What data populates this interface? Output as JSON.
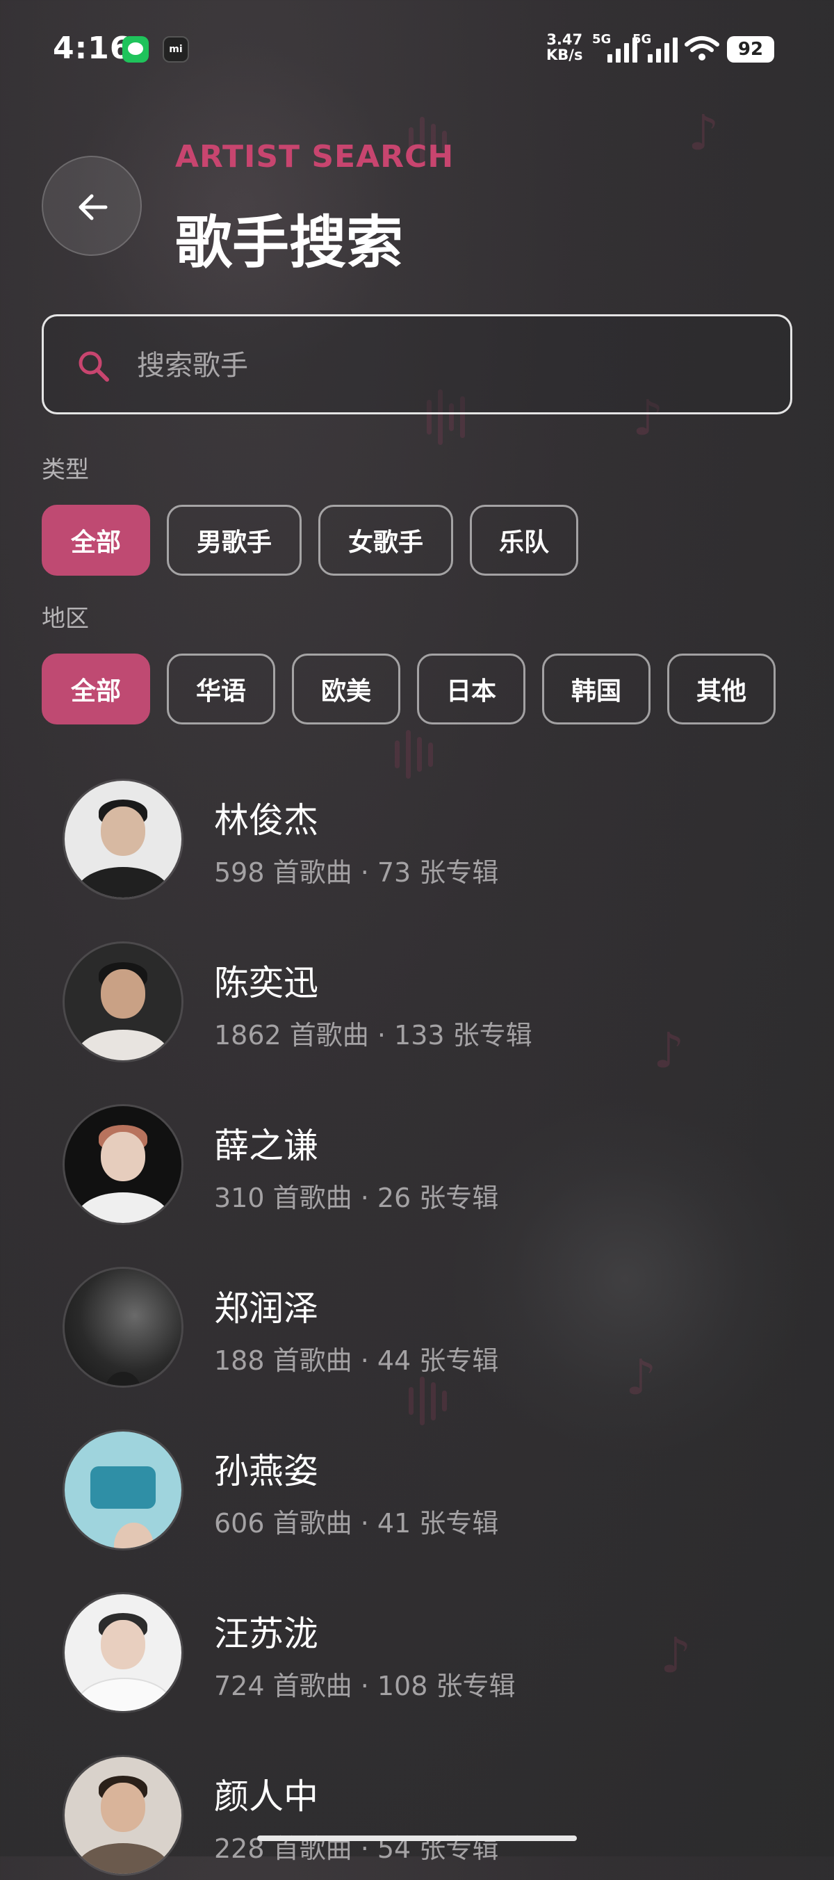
{
  "status_bar": {
    "time": "4:16",
    "net_speed_top": "3.47",
    "net_speed_bottom": "KB/s",
    "signal1_label": "5G",
    "signal2_label": "5G",
    "battery": "92"
  },
  "header": {
    "subtitle": "ARTIST SEARCH",
    "title": "歌手搜索"
  },
  "search": {
    "placeholder": "搜索歌手",
    "value": ""
  },
  "filters": {
    "type_label": "类型",
    "type_options": [
      "全部",
      "男歌手",
      "女歌手",
      "乐队"
    ],
    "type_selected": "全部",
    "region_label": "地区",
    "region_options": [
      "全部",
      "华语",
      "欧美",
      "日本",
      "韩国",
      "其他"
    ],
    "region_selected": "全部"
  },
  "artists": [
    {
      "name": "林俊杰",
      "stats": "598 首歌曲 · 73 张专辑"
    },
    {
      "name": "陈奕迅",
      "stats": "1862 首歌曲 · 133 张专辑"
    },
    {
      "name": "薛之谦",
      "stats": "310 首歌曲 · 26 张专辑"
    },
    {
      "name": "郑润泽",
      "stats": "188 首歌曲 · 44 张专辑"
    },
    {
      "name": "孙燕姿",
      "stats": "606 首歌曲 · 41 张专辑"
    },
    {
      "name": "汪苏泷",
      "stats": "724 首歌曲 · 108 张专辑"
    },
    {
      "name": "颜人中",
      "stats": "228 首歌曲 · 54 张专辑"
    }
  ],
  "colors": {
    "accent": "#bf4a72",
    "subtitle": "#c8456f",
    "background": "#2f2e30"
  }
}
